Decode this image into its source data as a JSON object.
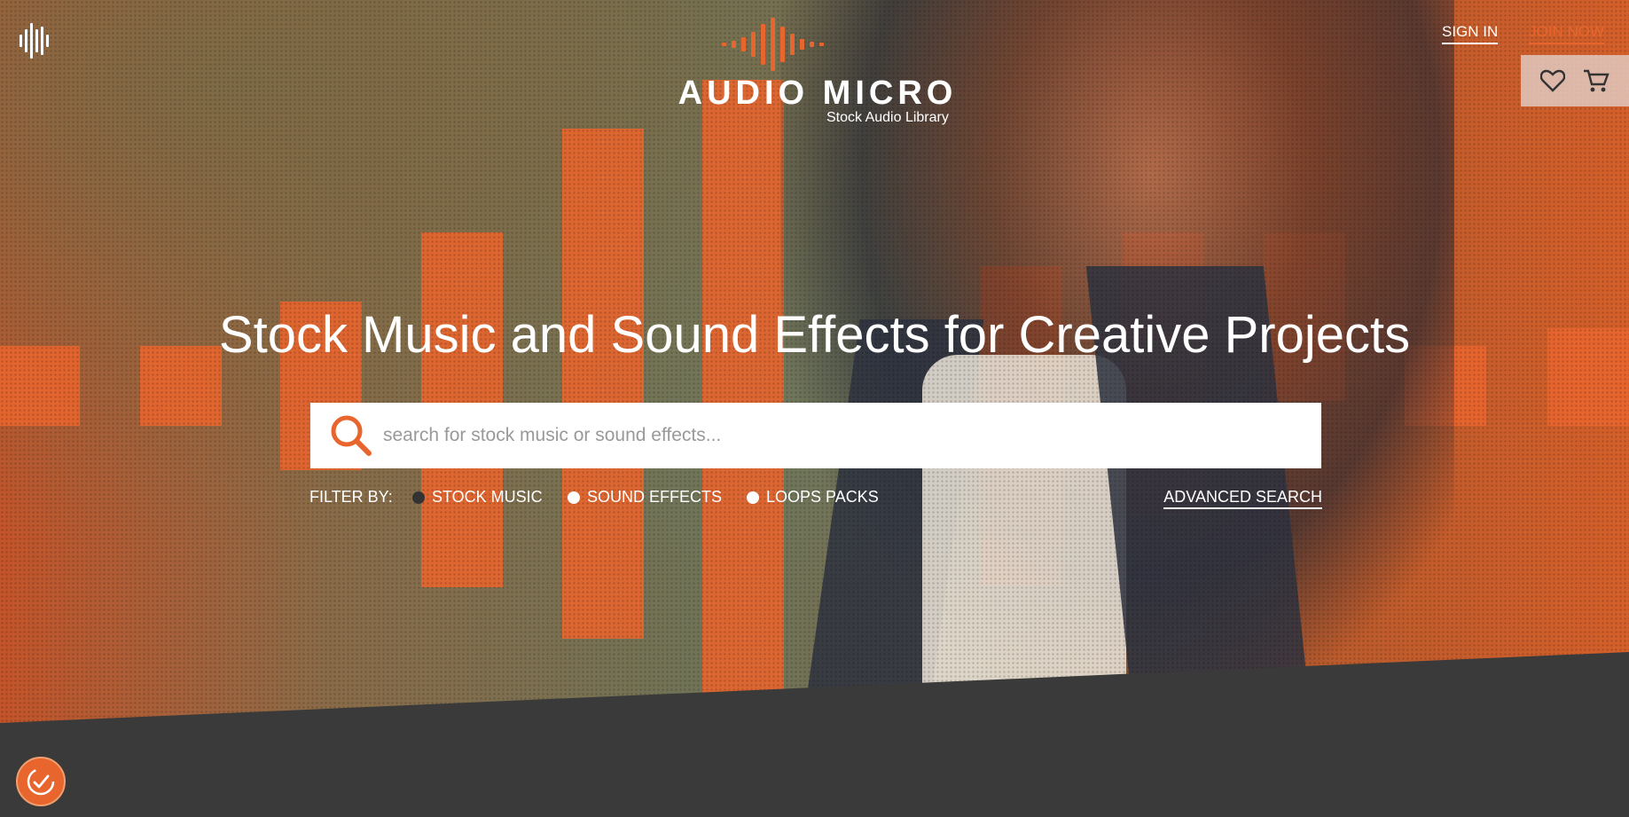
{
  "brand": {
    "name": "AUDIO MICRO",
    "tagline": "Stock Audio Library"
  },
  "nav": {
    "sign_in": "SIGN IN",
    "join_now": "JOIN NOW"
  },
  "hero": {
    "headline": "Stock Music and Sound Effects for Creative Projects"
  },
  "search": {
    "placeholder": "search for stock music or sound effects...",
    "value": ""
  },
  "filters": {
    "label": "FILTER BY:",
    "options": [
      {
        "label": "STOCK MUSIC",
        "selected": true
      },
      {
        "label": "SOUND EFFECTS",
        "selected": false
      },
      {
        "label": "LOOPS PACKS",
        "selected": false
      }
    ],
    "advanced_search": "ADVANCED SEARCH"
  },
  "icons": {
    "top_left": "audio-wave-icon",
    "favorites": "heart-icon",
    "cart": "cart-icon",
    "search": "search-icon",
    "consent": "cookie-consent-icon"
  },
  "colors": {
    "accent": "#e8652d",
    "dark_band": "#3a3a3a"
  }
}
